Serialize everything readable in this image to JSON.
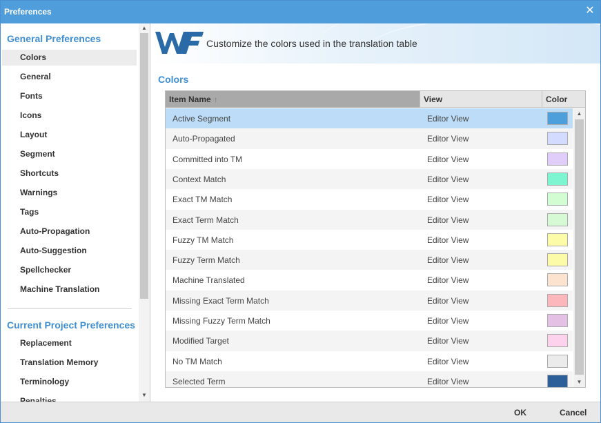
{
  "window": {
    "title": "Preferences",
    "close_icon": "close-icon"
  },
  "sidebar": {
    "general_title": "General Preferences",
    "general_items": [
      {
        "label": "Colors",
        "selected": true
      },
      {
        "label": "General"
      },
      {
        "label": "Fonts"
      },
      {
        "label": "Icons"
      },
      {
        "label": "Layout"
      },
      {
        "label": "Segment"
      },
      {
        "label": "Shortcuts"
      },
      {
        "label": "Warnings"
      },
      {
        "label": "Tags"
      },
      {
        "label": "Auto-Propagation"
      },
      {
        "label": "Auto-Suggestion"
      },
      {
        "label": "Spellchecker"
      },
      {
        "label": "Machine Translation"
      }
    ],
    "project_title": "Current Project Preferences",
    "project_items": [
      {
        "label": "Replacement"
      },
      {
        "label": "Translation Memory"
      },
      {
        "label": "Terminology"
      },
      {
        "label": "Penalties"
      }
    ]
  },
  "banner": {
    "logo_text": "WF",
    "tagline": "Customize the colors used in the translation table"
  },
  "main": {
    "heading": "Colors",
    "table": {
      "columns": {
        "name": "Item Name",
        "view": "View",
        "color": "Color"
      },
      "sort_icon": "sort-ascending-icon",
      "rows": [
        {
          "name": "Active Segment",
          "view": "Editor View",
          "color": "#4d9fdc",
          "active": true
        },
        {
          "name": "Auto-Propagated",
          "view": "Editor View",
          "color": "#d3dcff"
        },
        {
          "name": "Committed into TM",
          "view": "Editor View",
          "color": "#e0cdfa"
        },
        {
          "name": "Context Match",
          "view": "Editor View",
          "color": "#7df5d0"
        },
        {
          "name": "Exact TM Match",
          "view": "Editor View",
          "color": "#d2fcd2"
        },
        {
          "name": "Exact Term Match",
          "view": "Editor View",
          "color": "#d6fbd4"
        },
        {
          "name": "Fuzzy TM Match",
          "view": "Editor View",
          "color": "#fcfca8"
        },
        {
          "name": "Fuzzy Term Match",
          "view": "Editor View",
          "color": "#fcfca8"
        },
        {
          "name": "Machine Translated",
          "view": "Editor View",
          "color": "#fce3d0"
        },
        {
          "name": "Missing Exact Term Match",
          "view": "Editor View",
          "color": "#fcb7bd"
        },
        {
          "name": "Missing Fuzzy Term Match",
          "view": "Editor View",
          "color": "#e4c0e4"
        },
        {
          "name": "Modified Target",
          "view": "Editor View",
          "color": "#fcd2ec"
        },
        {
          "name": "No TM Match",
          "view": "Editor View",
          "color": "#ebebeb"
        },
        {
          "name": "Selected Term",
          "view": "Editor View",
          "color": "#2d5f99"
        }
      ]
    }
  },
  "footer": {
    "ok_label": "OK",
    "cancel_label": "Cancel"
  }
}
